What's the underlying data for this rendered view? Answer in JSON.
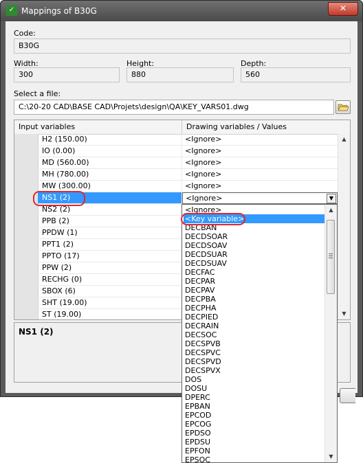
{
  "window": {
    "title": "Mappings of B30G",
    "close_label": "✕"
  },
  "form": {
    "code_label": "Code:",
    "code_value": "B30G",
    "width_label": "Width:",
    "width_value": "300",
    "height_label": "Height:",
    "height_value": "880",
    "depth_label": "Depth:",
    "depth_value": "560",
    "file_label": "Select a file:",
    "file_value": "C:\\20-20 CAD\\BASE CAD\\Projets\\design\\QA\\KEY_VARS01.dwg"
  },
  "grid": {
    "col_input": "Input variables",
    "col_drawing": "Drawing variables / Values",
    "rows": [
      {
        "input": "H2 (150.00)",
        "value": "<Ignore>"
      },
      {
        "input": "IO (0.00)",
        "value": "<Ignore>"
      },
      {
        "input": "MD (560.00)",
        "value": "<Ignore>"
      },
      {
        "input": "MH (780.00)",
        "value": "<Ignore>"
      },
      {
        "input": "MW (300.00)",
        "value": "<Ignore>"
      },
      {
        "input": "NS1 (2)",
        "value": "<Ignore>"
      },
      {
        "input": "NS2 (2)",
        "value": ""
      },
      {
        "input": "PPB (2)",
        "value": ""
      },
      {
        "input": "PPDW (1)",
        "value": ""
      },
      {
        "input": "PPT1 (2)",
        "value": ""
      },
      {
        "input": "PPTO (17)",
        "value": ""
      },
      {
        "input": "PPW (2)",
        "value": ""
      },
      {
        "input": "RECHG (0)",
        "value": ""
      },
      {
        "input": "SBOX (6)",
        "value": ""
      },
      {
        "input": "SHT (19.00)",
        "value": ""
      },
      {
        "input": "ST (19.00)",
        "value": ""
      }
    ],
    "selected_index": 5
  },
  "description": {
    "text": "NS1 (2)"
  },
  "dropdown": {
    "items": [
      "<Ignore>",
      "<Key variable>",
      "DECBAN",
      "DECDSOAR",
      "DECDSOAV",
      "DECDSUAR",
      "DECDSUAV",
      "DECFAC",
      "DECPAR",
      "DECPAV",
      "DECPBA",
      "DECPHA",
      "DECPIED",
      "DECRAIN",
      "DECSOC",
      "DECSPVB",
      "DECSPVC",
      "DECSPVD",
      "DECSPVX",
      "DOS",
      "DOSU",
      "DPERC",
      "EPBAN",
      "EPCOD",
      "EPCOG",
      "EPDSO",
      "EPDSU",
      "EPFON",
      "EPSOC"
    ],
    "highlighted_index": 1
  },
  "icons": {
    "app": "app-icon",
    "folder": "folder-open-icon",
    "combo": "chevron-down-icon"
  },
  "colors": {
    "selection": "#3399ff",
    "annotation": "#e0262e",
    "titlebar": "#5a5a5a"
  }
}
